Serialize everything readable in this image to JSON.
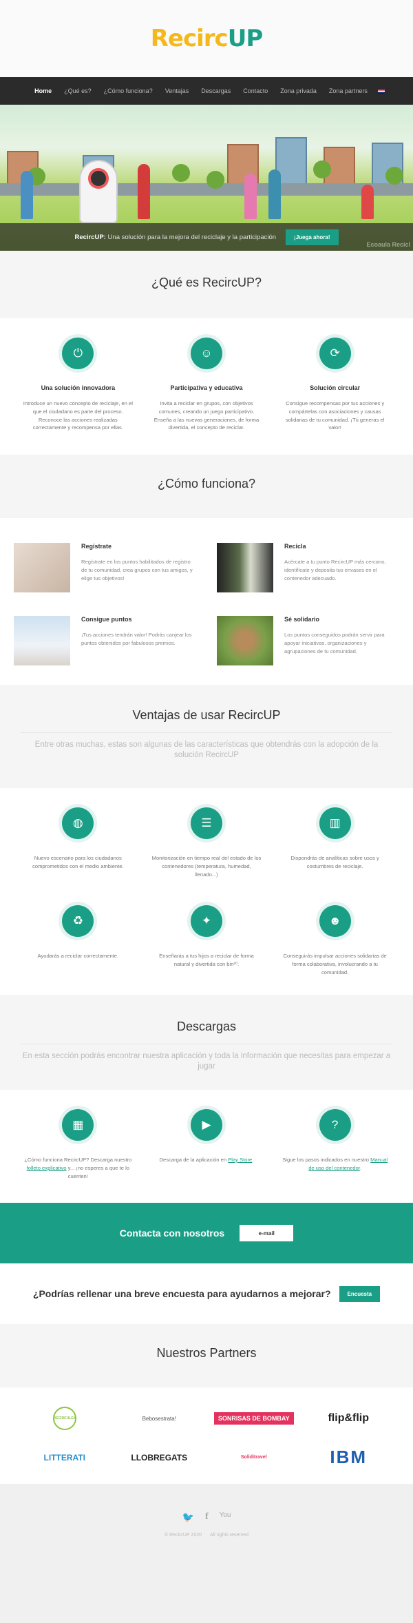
{
  "brand": {
    "logo_re": "Re",
    "logo_circ": "circ",
    "logo_up": "UP"
  },
  "nav": {
    "items": [
      "Home",
      "¿Qué es?",
      "¿Cómo funciona?",
      "Ventajas",
      "Descargas",
      "Contacto",
      "Zona privada",
      "Zona partners"
    ],
    "flag": "uk-flag-icon"
  },
  "hero": {
    "tag_bold": "RecircUP:",
    "tag_text": " Una solución para la mejora del reciclaje y la participación",
    "cta": "¡Juega ahora!",
    "watermark": "Ecoaula Recicl"
  },
  "que": {
    "title": "¿Qué es RecircUP?",
    "items": [
      {
        "icon": "power-icon",
        "title": "Una solución innovadora",
        "text": "Introduce un nuevo concepto de reciclaje, en el que el ciudadano es parte del proceso. Reconoce las acciones realizadas correctamente y recompensa por ellas."
      },
      {
        "icon": "person-icon",
        "title": "Participativa y educativa",
        "text": "Invita a reciclar en grupos, con objetivos comunes, creando un juego participativo. Enseña a las nuevas generaciones, de forma divertida, el concepto de reciclar."
      },
      {
        "icon": "refresh-icon",
        "title": "Solución circular",
        "text": "Consigue recompensas por tus acciones y compártelas con asociaciones y causas solidarias de tu comunidad. ¡Tú generas el valor!"
      }
    ]
  },
  "como": {
    "title": "¿Cómo funciona?",
    "items": [
      {
        "title": "Regístrate",
        "text": "Regístrate en los puntos habilitados de registro de tu comunidad, crea grupos con tus amigos, y elige tus objetivos!"
      },
      {
        "title": "Recicla",
        "text": "Acércate a tu punto RecircUP más cercano, identifícate y deposita tus envases en el contenedor adecuado."
      },
      {
        "title": "Consigue puntos",
        "text": "¡Tus acciones tendrán valor! Podrás canjear los puntos obtenidos por fabulosos premios."
      },
      {
        "title": "Sé solidario",
        "text": "Los puntos conseguidos podrán servir para apoyar iniciativas, organizaciones y agrupaciones de tu comunidad."
      }
    ]
  },
  "ventajas": {
    "title": "Ventajas de usar RecircUP",
    "subtitle": "Entre otras muchas, estas son algunas de las características que obtendrás con la adopción de la solución RecircUP",
    "items": [
      {
        "icon": "globe-icon",
        "text": "Nuevo escenario para los ciudadanos comprometidos con el medio ambiente."
      },
      {
        "icon": "server-icon",
        "text": "Monitorización en tiempo real del estado de los contenedores (temperatura, humedad, llenado...)"
      },
      {
        "icon": "bar-chart-icon",
        "text": "Dispondrás de analíticas sobre usos y costumbres de reciclaje."
      },
      {
        "icon": "recycle-icon",
        "text": "Ayudarás a reciclar correctamente."
      },
      {
        "icon": "child-icon",
        "text": "Enseñarás a tus hijos a reciclar de forma natural y divertida con bin²⁰."
      },
      {
        "icon": "group-icon",
        "text": "Conseguirás impulsar acciones solidarias de forma colaborativa, involucrando a tu comunidad."
      }
    ]
  },
  "descargas": {
    "title": "Descargas",
    "subtitle": "En esta sección podrás encontrar nuestra aplicación y toda la información que necesitas para empezar a jugar",
    "items": [
      {
        "icon": "map-icon",
        "text_a": "¿Cómo funciona RecircUP? Descarga nuestro ",
        "link": "folleto explicativo",
        "text_b": " y... ¡no esperes a que te lo cuenten!"
      },
      {
        "icon": "play-icon",
        "text_a": "Descarga de la aplicación en ",
        "link": "Play Store",
        "text_b": "."
      },
      {
        "icon": "question-icon",
        "text_a": "Sigue los pasos indicados en nuestro ",
        "link": "Manual de uso del contenedor",
        "text_b": "."
      }
    ]
  },
  "contact": {
    "label": "Contacta con nosotros",
    "button": "e-mail"
  },
  "survey": {
    "label": "¿Podrías rellenar una breve encuesta para ayudarnos a mejorar?",
    "button": "Encuesta"
  },
  "partners": {
    "title": "Nuestros Partners",
    "items": [
      "RECIRCULEX",
      "Bebosestrata!",
      "SONRISAS DE BOMBAY",
      "flip&flip",
      "LITTERATI",
      "LLOBREGATS",
      "Soliditravel",
      "IBM"
    ]
  },
  "footer": {
    "copyright": "© RecircUP 2020",
    "rights": "All rights reserved",
    "social": [
      "twitter-icon",
      "facebook-icon",
      "youtube-icon"
    ]
  },
  "colors": {
    "accent": "#1a9f86",
    "logo_yellow": "#f5b81c",
    "nav_bg": "#2b2b2b"
  }
}
